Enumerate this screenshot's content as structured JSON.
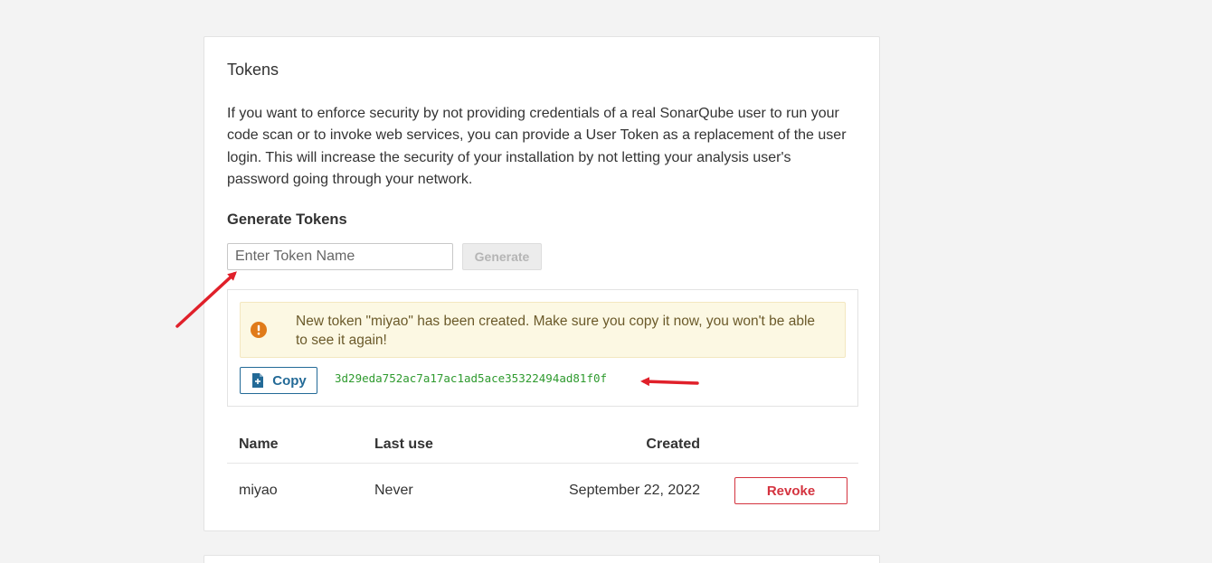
{
  "tokens_card": {
    "title": "Tokens",
    "description": "If you want to enforce security by not providing credentials of a real SonarQube user to run your code scan or to invoke web services, you can provide a User Token as a replacement of the user login. This will increase the security of your installation by not letting your analysis user's password going through your network.",
    "generate": {
      "heading": "Generate Tokens",
      "input_placeholder": "Enter Token Name",
      "input_value": "",
      "button_label": "Generate"
    },
    "new_token": {
      "alert_message": "New token \"miyao\" has been created. Make sure you copy it now, you won't be able to see it again!",
      "copy_label": "Copy",
      "token_value": "3d29eda752ac7a17ac1ad5ace35322494ad81f0f"
    },
    "table": {
      "headers": {
        "name": "Name",
        "last_use": "Last use",
        "created": "Created"
      },
      "rows": [
        {
          "name": "miyao",
          "last_use": "Never",
          "created": "September 22, 2022",
          "action_label": "Revoke"
        }
      ]
    }
  },
  "icons": {
    "alert": "exclamation-circle-icon",
    "copy": "clipboard-icon"
  },
  "colors": {
    "page_bg": "#f3f3f3",
    "alert_bg": "#fcf8e3",
    "alert_icon": "#e07b1a",
    "primary": "#236a97",
    "danger": "#d4333f",
    "token_text": "#2e9a2e",
    "annotation_arrow": "#e0202a"
  }
}
